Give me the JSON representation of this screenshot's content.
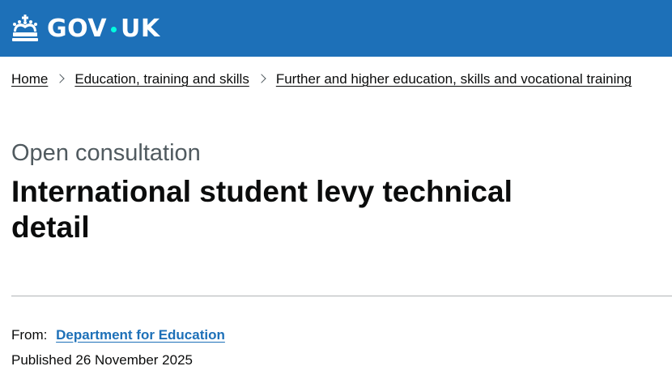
{
  "header": {
    "logo_text_left": "GOV",
    "logo_text_right": "UK",
    "brand_color": "#1d70b8",
    "dot_color": "#00ffe0",
    "crown_icon": "crown-icon"
  },
  "breadcrumbs": [
    {
      "label": "Home"
    },
    {
      "label": "Education, training and skills"
    },
    {
      "label": "Further and higher education, skills and vocational training"
    }
  ],
  "page": {
    "caption": "Open consultation",
    "title": "International student levy technical detail"
  },
  "metadata": {
    "from_label": "From:",
    "organisation": "Department for Education",
    "published": "Published 26 November 2025"
  }
}
